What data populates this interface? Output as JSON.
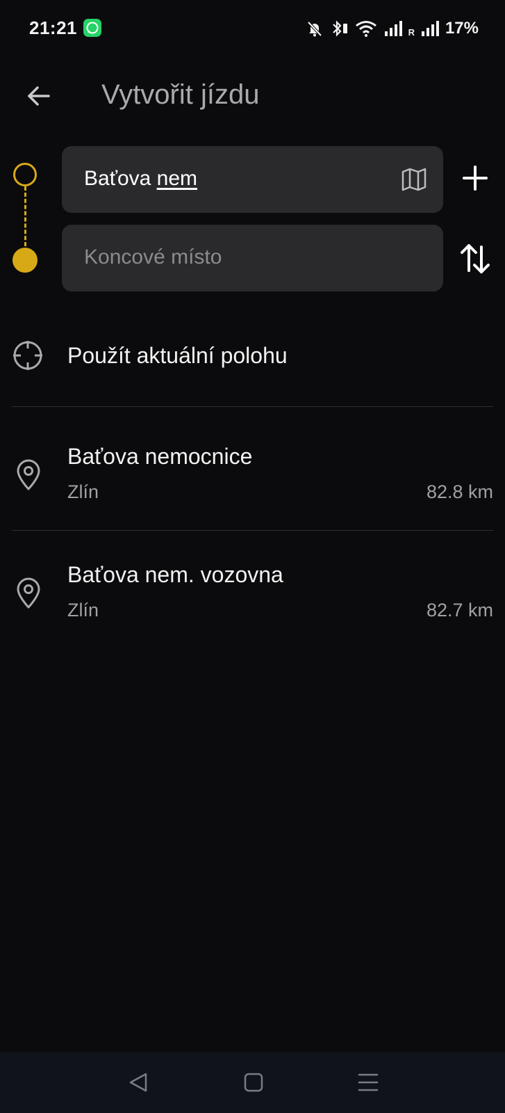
{
  "status_bar": {
    "time": "21:21",
    "roaming_label": "R",
    "battery": "17%",
    "icons": [
      "whatsapp-icon",
      "bell-off-icon",
      "bluetooth-icon",
      "wifi-icon",
      "signal-icon",
      "signal-roaming-icon"
    ]
  },
  "header": {
    "title": "Vytvořit jízdu",
    "back_icon": "arrow-left-icon"
  },
  "route": {
    "start_value_plain": "Baťova ",
    "start_value_underlined": "nem",
    "end_placeholder": "Koncové místo",
    "accent_color": "#d8a917",
    "map_icon": "map-icon",
    "add_icon": "plus-icon",
    "swap_icon": "swap-vertical-icon"
  },
  "current_location": {
    "label": "Použít aktuální polohu",
    "icon": "crosshair-icon"
  },
  "results": [
    {
      "name": "Baťova nemocnice",
      "city": "Zlín",
      "distance": "82.8 km",
      "icon": "map-pin-icon"
    },
    {
      "name": "Baťova nem. vozovna",
      "city": "Zlín",
      "distance": "82.7 km",
      "icon": "map-pin-icon"
    }
  ],
  "nav_bar": {
    "icons": [
      "nav-back-icon",
      "nav-home-icon",
      "nav-recents-icon"
    ]
  }
}
